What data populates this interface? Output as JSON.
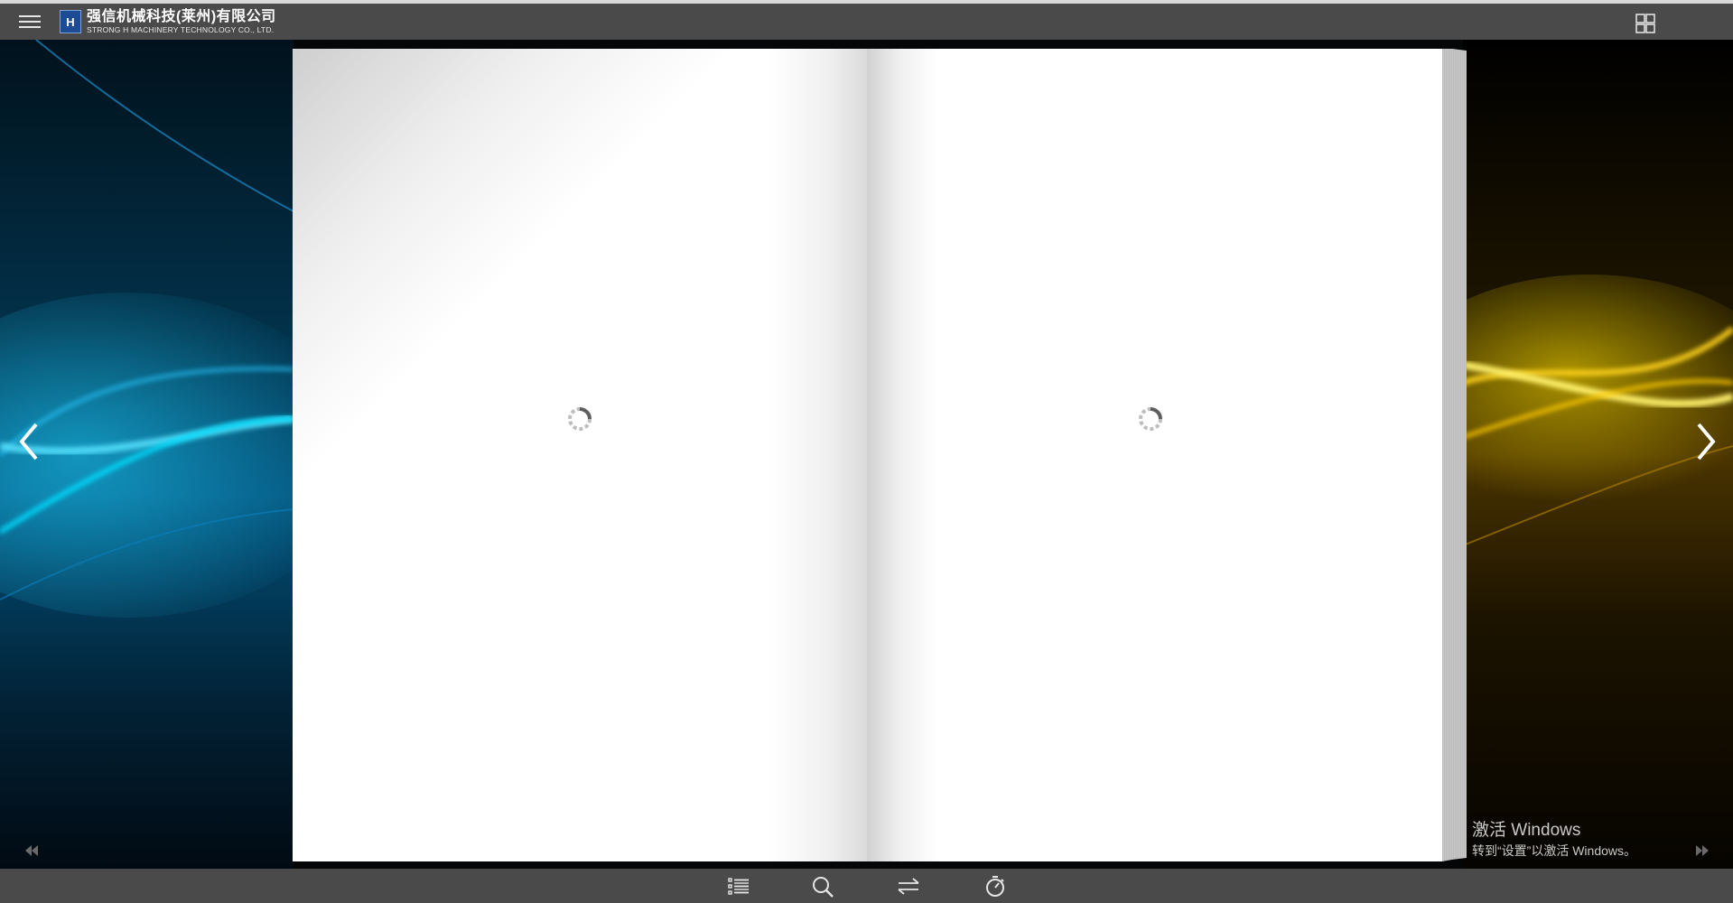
{
  "header": {
    "company_name_cn": "强信机械科技(莱州)有限公司",
    "company_name_en": "STRONG H MACHINERY TECHNOLOGY CO., LTD.",
    "logo_letter": "H",
    "menu_icon": "hamburger-menu-icon",
    "thumbnails_icon": "grid-thumbnails-icon"
  },
  "book": {
    "left_page_status": "loading",
    "right_page_status": "loading"
  },
  "navigation": {
    "prev_icon": "chevron-left-icon",
    "next_icon": "chevron-right-icon",
    "first_icon": "double-chevron-left-icon",
    "last_icon": "double-chevron-right-icon"
  },
  "toolbar": {
    "items": [
      {
        "name": "table-of-contents",
        "icon": "list-icon"
      },
      {
        "name": "search",
        "icon": "search-icon"
      },
      {
        "name": "auto-flip",
        "icon": "swap-arrows-icon"
      },
      {
        "name": "timer",
        "icon": "stopwatch-icon"
      }
    ]
  },
  "watermark": {
    "line1": "激活 Windows",
    "line2": "转到“设置”以激活 Windows。"
  },
  "colors": {
    "bar": "#4a4a4a",
    "left_glow": "#00c8ff",
    "right_glow": "#ffd400",
    "logo_blue": "#1d4c97"
  }
}
